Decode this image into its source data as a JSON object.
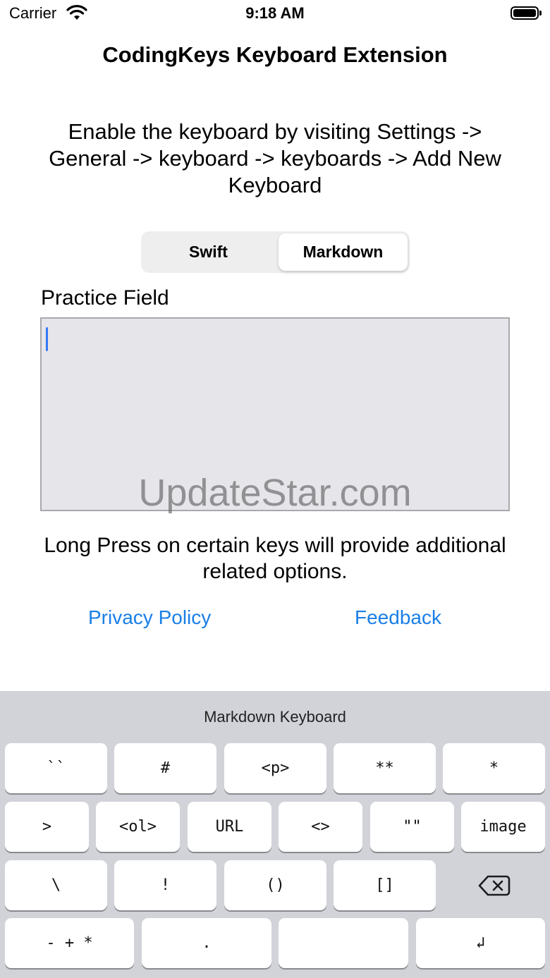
{
  "status_bar": {
    "carrier": "Carrier",
    "time": "9:18 AM"
  },
  "app": {
    "title": "CodingKeys Keyboard Extension",
    "instructions": "Enable the keyboard by visiting Settings -> General -> keyboard -> keyboards -> Add New Keyboard",
    "segments": [
      "Swift",
      "Markdown"
    ],
    "selected_segment": "Markdown",
    "practice_label": "Practice Field",
    "practice_value": "",
    "watermark": "UpdateStar.com",
    "note": "Long Press on certain keys will provide additional related options.",
    "privacy_link": "Privacy Policy",
    "feedback_link": "Feedback"
  },
  "keyboard": {
    "title": "Markdown Keyboard",
    "row1": [
      "``",
      "#",
      "<p>",
      "**",
      "*"
    ],
    "row2": [
      ">",
      "<ol>",
      "URL",
      "<>",
      "\"\"",
      "image"
    ],
    "row3": [
      "\\",
      "!",
      "()",
      "[]"
    ],
    "row4": [
      "- + *",
      ".",
      "",
      "↲"
    ]
  },
  "colors": {
    "link": "#1a7fe6",
    "cursor": "#3478f6",
    "keyboard_bg": "#d1d3d9"
  }
}
